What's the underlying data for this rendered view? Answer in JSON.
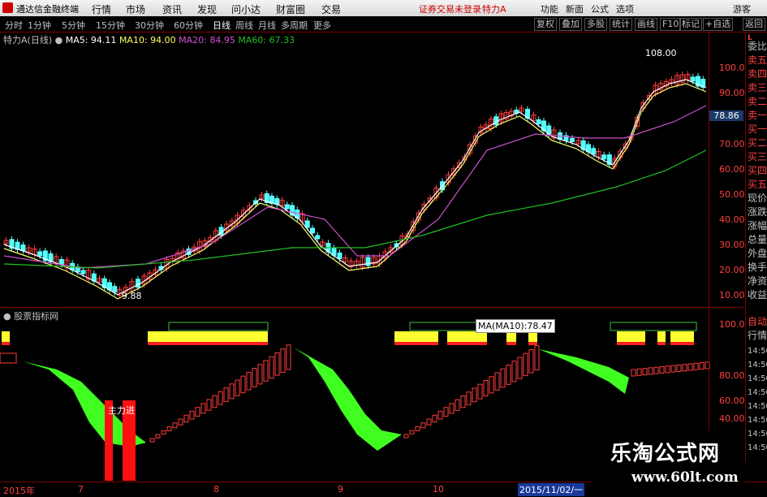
{
  "titlebar": {
    "app_name": "通达信金融终端",
    "menus": [
      "行情",
      "市场",
      "资讯",
      "发现",
      "问小达",
      "财富圈",
      "交易"
    ],
    "warning": "证券交易未登录",
    "stock_label": "特力A",
    "right_items": [
      "功能",
      "新面",
      "公式",
      "选项"
    ],
    "guest": "游客"
  },
  "tabbar": {
    "tabs": [
      "分时",
      "1分钟",
      "5分钟",
      "15分钟",
      "30分钟",
      "60分钟",
      "日线",
      "周线",
      "月线",
      "多周期",
      "更多"
    ],
    "active_tab": "日线",
    "buttons": [
      "复权",
      "叠加",
      "多股",
      "统计",
      "画线",
      "F10",
      "标记",
      "+自选",
      "返回"
    ]
  },
  "info": {
    "stock": "特力A(日线)",
    "ma5": "MA5: 94.11",
    "ma10": "MA10: 94.00",
    "ma20": "MA20: 84.95",
    "ma60": "MA60: 67.33"
  },
  "side_panel": {
    "title": "L",
    "items": [
      "委比",
      "卖五",
      "卖四",
      "卖三",
      "卖二",
      "卖一",
      "买一",
      "买二",
      "买三",
      "买四",
      "买五",
      "现价",
      "涨跌",
      "涨幅",
      "总量",
      "外盘",
      "换手",
      "净资",
      "收益"
    ],
    "bottom_items": [
      "自动",
      "行情",
      "14:50",
      "14:50",
      "14:50",
      "14:50",
      "14:50",
      "14:50",
      "14:50",
      "14:50"
    ]
  },
  "axes": {
    "price_ticks": [
      "100.00",
      "90.00",
      "80.00",
      "70.00",
      "60.00",
      "50.00",
      "40.00",
      "30.00",
      "20.00",
      "10.00"
    ],
    "current_price": "78.86",
    "sub_ticks": [
      "100.0",
      "80.00",
      "60.00",
      "40.00"
    ],
    "annot_high": "108.00",
    "annot_low": "9.88"
  },
  "subchart": {
    "title": "股票指标网",
    "label_main": "主力进",
    "tooltip": "MA(MA10):78.47"
  },
  "bottom_axis": {
    "labels": [
      "2015年",
      "7",
      "8",
      "9",
      "10"
    ],
    "date_box": "2015/11/02/一"
  },
  "watermark": {
    "line1": "乐淘公式网",
    "line2": "www.60lt.com"
  },
  "colors": {
    "up": "#ff3b3b",
    "down": "#54ffff",
    "ma5": "#ffffff",
    "ma10": "#ffff66",
    "ma20": "#d050d0",
    "ma60": "#20c020",
    "green_fill": "#40ff20",
    "red_bar": "#ff1010"
  }
}
